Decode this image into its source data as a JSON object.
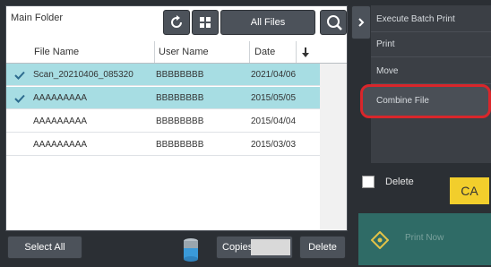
{
  "folder": {
    "title": "Main Folder"
  },
  "toolbar": {
    "all_files": "All Files"
  },
  "table": {
    "headers": {
      "file": "File Name",
      "user": "User Name",
      "date": "Date"
    },
    "rows": [
      {
        "name": "Scan_20210406_085320",
        "user": "BBBBBBBB",
        "date": "2021/04/06",
        "selected": true
      },
      {
        "name": "AAAAAAAAA",
        "user": "BBBBBBBB",
        "date": "2015/05/05",
        "selected": true
      },
      {
        "name": "AAAAAAAAA",
        "user": "BBBBBBBB",
        "date": "2015/04/04",
        "selected": false
      },
      {
        "name": "AAAAAAAAA",
        "user": "BBBBBBBB",
        "date": "2015/03/03",
        "selected": false
      }
    ]
  },
  "bottom": {
    "select_all": "Select All",
    "copies": "Copies",
    "delete": "Delete"
  },
  "menu": {
    "execute": "Execute Batch Print",
    "print": "Print",
    "move": "Move",
    "combine": "Combine File"
  },
  "delete_check": {
    "label": "Delete"
  },
  "ca": "CA",
  "start": {
    "label": "Print Now"
  },
  "colors": {
    "selected_row": "#a7dde3",
    "highlight": "#d9262b",
    "ca": "#f2ce2c"
  }
}
